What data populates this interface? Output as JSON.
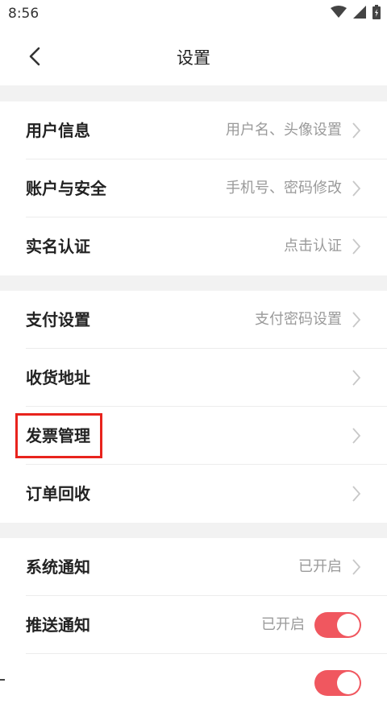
{
  "status_bar": {
    "time": "8:56"
  },
  "header": {
    "title": "设置"
  },
  "groups": [
    {
      "items": [
        {
          "label": "用户信息",
          "value": "用户名、头像设置"
        },
        {
          "label": "账户与安全",
          "value": "手机号、密码修改"
        },
        {
          "label": "实名认证",
          "value": "点击认证"
        }
      ]
    },
    {
      "items": [
        {
          "label": "支付设置",
          "value": "支付密码设置"
        },
        {
          "label": "收货地址",
          "value": ""
        },
        {
          "label": "发票管理",
          "value": ""
        },
        {
          "label": "订单回收",
          "value": ""
        }
      ]
    },
    {
      "items": [
        {
          "label": "系统通知",
          "value": "已开启"
        },
        {
          "label": "推送通知",
          "value": "已开启",
          "toggle_on": true
        },
        {
          "label": "",
          "value": "",
          "toggle_on": true
        }
      ]
    }
  ],
  "colors": {
    "accent": "#f0575f",
    "highlight_box": "#e8231d",
    "section_gap": "#f2f2f2"
  }
}
